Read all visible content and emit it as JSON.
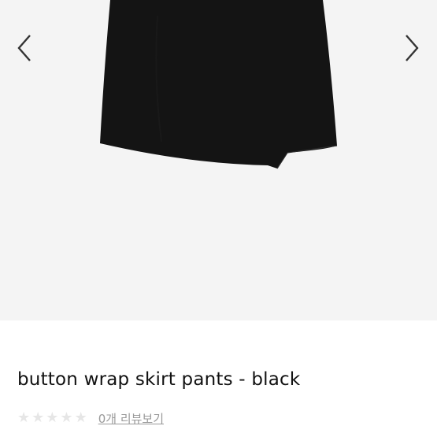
{
  "product": {
    "title": "button wrap skirt pants - black"
  },
  "rating": {
    "stars": 0,
    "max_stars": 5,
    "review_link": "0개 리뷰보기"
  },
  "icons": {
    "prev": "chevron-left-icon",
    "next": "chevron-right-icon",
    "star": "star-icon"
  },
  "colors": {
    "gallery_bg": "#f4f4f4",
    "garment": "#111111",
    "star_empty": "#e6e6e6",
    "link": "#9a9a9a"
  }
}
